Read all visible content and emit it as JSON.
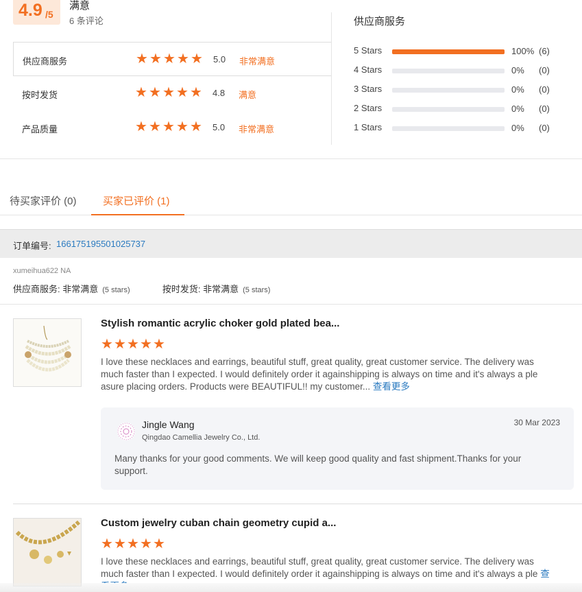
{
  "summary": {
    "score": "4.9",
    "score_suffix": "/5",
    "label": "满意",
    "review_count": "6 条评论",
    "metrics": [
      {
        "name": "供应商服务",
        "stars": 5,
        "score": "5.0",
        "desc": "非常满意"
      },
      {
        "name": "按时发货",
        "stars": 4.8,
        "score": "4.8",
        "desc": "满意"
      },
      {
        "name": "产品质量",
        "stars": 5,
        "score": "5.0",
        "desc": "非常满意"
      }
    ]
  },
  "supplier_service": {
    "title": "供应商服务",
    "rows": [
      {
        "label": "5 Stars",
        "fraction": 1.0,
        "pct": "100%",
        "count": "(6)"
      },
      {
        "label": "4 Stars",
        "fraction": 0.0,
        "pct": "0%",
        "count": "(0)"
      },
      {
        "label": "3 Stars",
        "fraction": 0.0,
        "pct": "0%",
        "count": "(0)"
      },
      {
        "label": "2 Stars",
        "fraction": 0.0,
        "pct": "0%",
        "count": "(0)"
      },
      {
        "label": "1 Stars",
        "fraction": 0.0,
        "pct": "0%",
        "count": "(0)"
      }
    ]
  },
  "tabs": {
    "pending": "待买家评价 (0)",
    "done": "买家已评价 (1)"
  },
  "order": {
    "label": "订单编号:",
    "number": "166175195501025737"
  },
  "buyer": {
    "name": "xumeihua622 NA",
    "service_label": "供应商服务:",
    "service_value": "非常满意",
    "service_stars": "(5 stars)",
    "shipping_label": "按时发货:",
    "shipping_value": "非常满意",
    "shipping_stars": "(5 stars)"
  },
  "reviews": [
    {
      "title": "Stylish romantic acrylic choker gold plated bea...",
      "stars": 5,
      "text": "I love these necklaces and earrings, beautiful stuff, great quality, great customer service. The delivery was much faster than I expected. I would definitely order it againshipping is always on time and it's always a ple asure placing orders. Products were BEAUTIFUL!! my customer...",
      "more": "查看更多",
      "reply": {
        "name": "Jingle Wang",
        "company": "Qingdao Camellia Jewelry Co., Ltd.",
        "date": "30 Mar 2023",
        "text": "Many thanks for your good comments. We will keep good quality and fast shipment.Thanks for your support."
      }
    },
    {
      "title": "Custom jewelry cuban chain geometry cupid a...",
      "stars": 5,
      "text": "I love these necklaces and earrings, beautiful stuff, great quality, great customer service. The delivery was much faster than I expected. I would definitely order it againshipping is always on time and it's always a ple",
      "more": "查看更多"
    }
  ],
  "colors": {
    "accent": "#f26f21",
    "link": "#2a7ac0",
    "badge_bg": "#fde8d9"
  }
}
